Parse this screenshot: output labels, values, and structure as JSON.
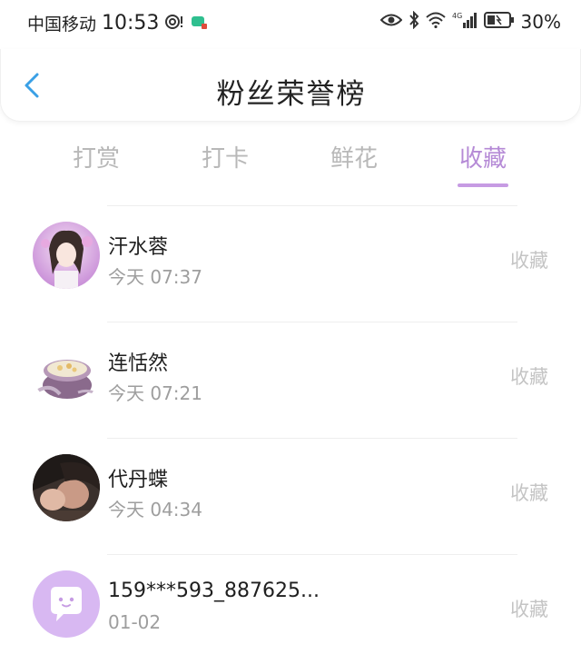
{
  "status_bar": {
    "carrier": "中国移动",
    "time": "10:53",
    "battery": "30%"
  },
  "header": {
    "title": "粉丝荣誉榜"
  },
  "tabs": [
    {
      "label": "打赏",
      "active": false
    },
    {
      "label": "打卡",
      "active": false
    },
    {
      "label": "鲜花",
      "active": false
    },
    {
      "label": "收藏",
      "active": true
    }
  ],
  "list": [
    {
      "name": "汗水蓉",
      "time": "今天 07:37",
      "action": "收藏"
    },
    {
      "name": "连恬然",
      "time": "今天 07:21",
      "action": "收藏"
    },
    {
      "name": "代丹蝶",
      "time": "今天 04:34",
      "action": "收藏"
    },
    {
      "name": "159***593_887625...",
      "time": "01-02",
      "action": "收藏"
    }
  ],
  "colors": {
    "accent": "#b58ad6",
    "tab_inactive": "#b8b8b8",
    "back_arrow": "#3aa0e6",
    "default_avatar": "#d8b8f2"
  }
}
